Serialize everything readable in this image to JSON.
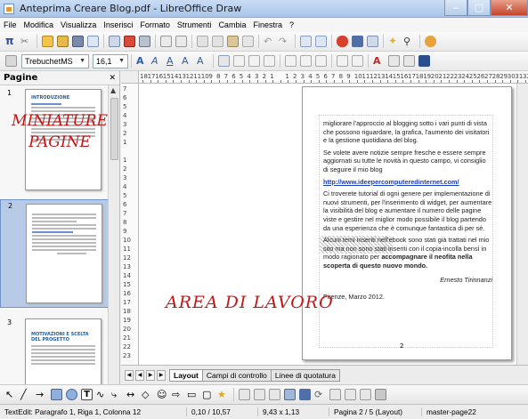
{
  "window": {
    "title": "Anteprima Creare Blog.pdf - LibreOffice Draw"
  },
  "menu": [
    "File",
    "Modifica",
    "Visualizza",
    "Inserisci",
    "Formato",
    "Strumenti",
    "Cambia",
    "Finestra",
    "?"
  ],
  "toolbar": {
    "font": "TrebuchetMS",
    "size": "16,1"
  },
  "pages_panel": {
    "title": "Pagine",
    "pages": [
      {
        "num": "1",
        "heading": "INTRODUZIONE"
      },
      {
        "num": "2",
        "heading": ""
      },
      {
        "num": "3",
        "heading": "MOTIVAZIONI E SCELTA DEL PROGETTO"
      }
    ]
  },
  "overlay": {
    "miniature": "MINIATURE PAGINE",
    "lavoro": "AREA DI LAVORO"
  },
  "ruler": {
    "h": [
      "18",
      "17",
      "16",
      "15",
      "14",
      "13",
      "12",
      "11",
      "10",
      "9",
      "8",
      "7",
      "6",
      "5",
      "4",
      "3",
      "2",
      "1",
      "",
      "1",
      "2",
      "3",
      "4",
      "5",
      "6",
      "7",
      "8",
      "9",
      "10",
      "11",
      "12",
      "13",
      "14",
      "15",
      "16",
      "17",
      "18",
      "19",
      "20",
      "21",
      "22",
      "23",
      "24",
      "25",
      "26",
      "27",
      "28",
      "29",
      "30",
      "31",
      "32"
    ],
    "v": [
      "7",
      "6",
      "5",
      "4",
      "3",
      "2",
      "1",
      "",
      "1",
      "2",
      "3",
      "4",
      "5",
      "6",
      "7",
      "8",
      "9",
      "10",
      "11",
      "12",
      "13",
      "14",
      "15",
      "16",
      "17",
      "18",
      "19",
      "20",
      "21",
      "22",
      "23"
    ]
  },
  "document": {
    "p1": "migliorare l'approccio al blogging sotto i vari punti di vista che possono riguardare, la grafica, l'aumento dei visitatori e la gestione quotidiana del blog.",
    "p2": "Se volete avere notizie sempre fresche e essere sempre aggiornati su tutte le novità in questo campo, vi consiglio di seguire il mio blog",
    "link": "http://www.ideepercomputeredinternet.com/",
    "p3": "Ci troverete tutorial di ogni genere per implementazione di nuovi strumenti, per l'inserimento di widget, per aumentare la visibilità del blog e aumentare il numero delle pagine viste e gestire nel miglior modo possibile il blog partendo da una esperienza che è comunque fantastica di per sé.",
    "p4a": "Alcuni temi inseriti nell'ebook sono stati già trattati nel mio sito ma non sono stati inseriti con il copia-incolla bensì in modo ragionato per ",
    "p4b": "accompagnare il neofita nella scoperta di questo nuovo mondo.",
    "sign": "Ernesto Tirinnanzi",
    "date": "Firenze, Marzo 2012.",
    "pagenum": "2"
  },
  "tabs": [
    "Layout",
    "Campi di controllo",
    "Linee di quotatura"
  ],
  "status": {
    "edit": "TextEdit: Paragrafo 1, Riga 1, Colonna 12",
    "pos": "0,10 / 10,57",
    "size": "9,43 x 1,13",
    "page": "Pagina 2 / 5 (Layout)",
    "master": "master-page22"
  }
}
